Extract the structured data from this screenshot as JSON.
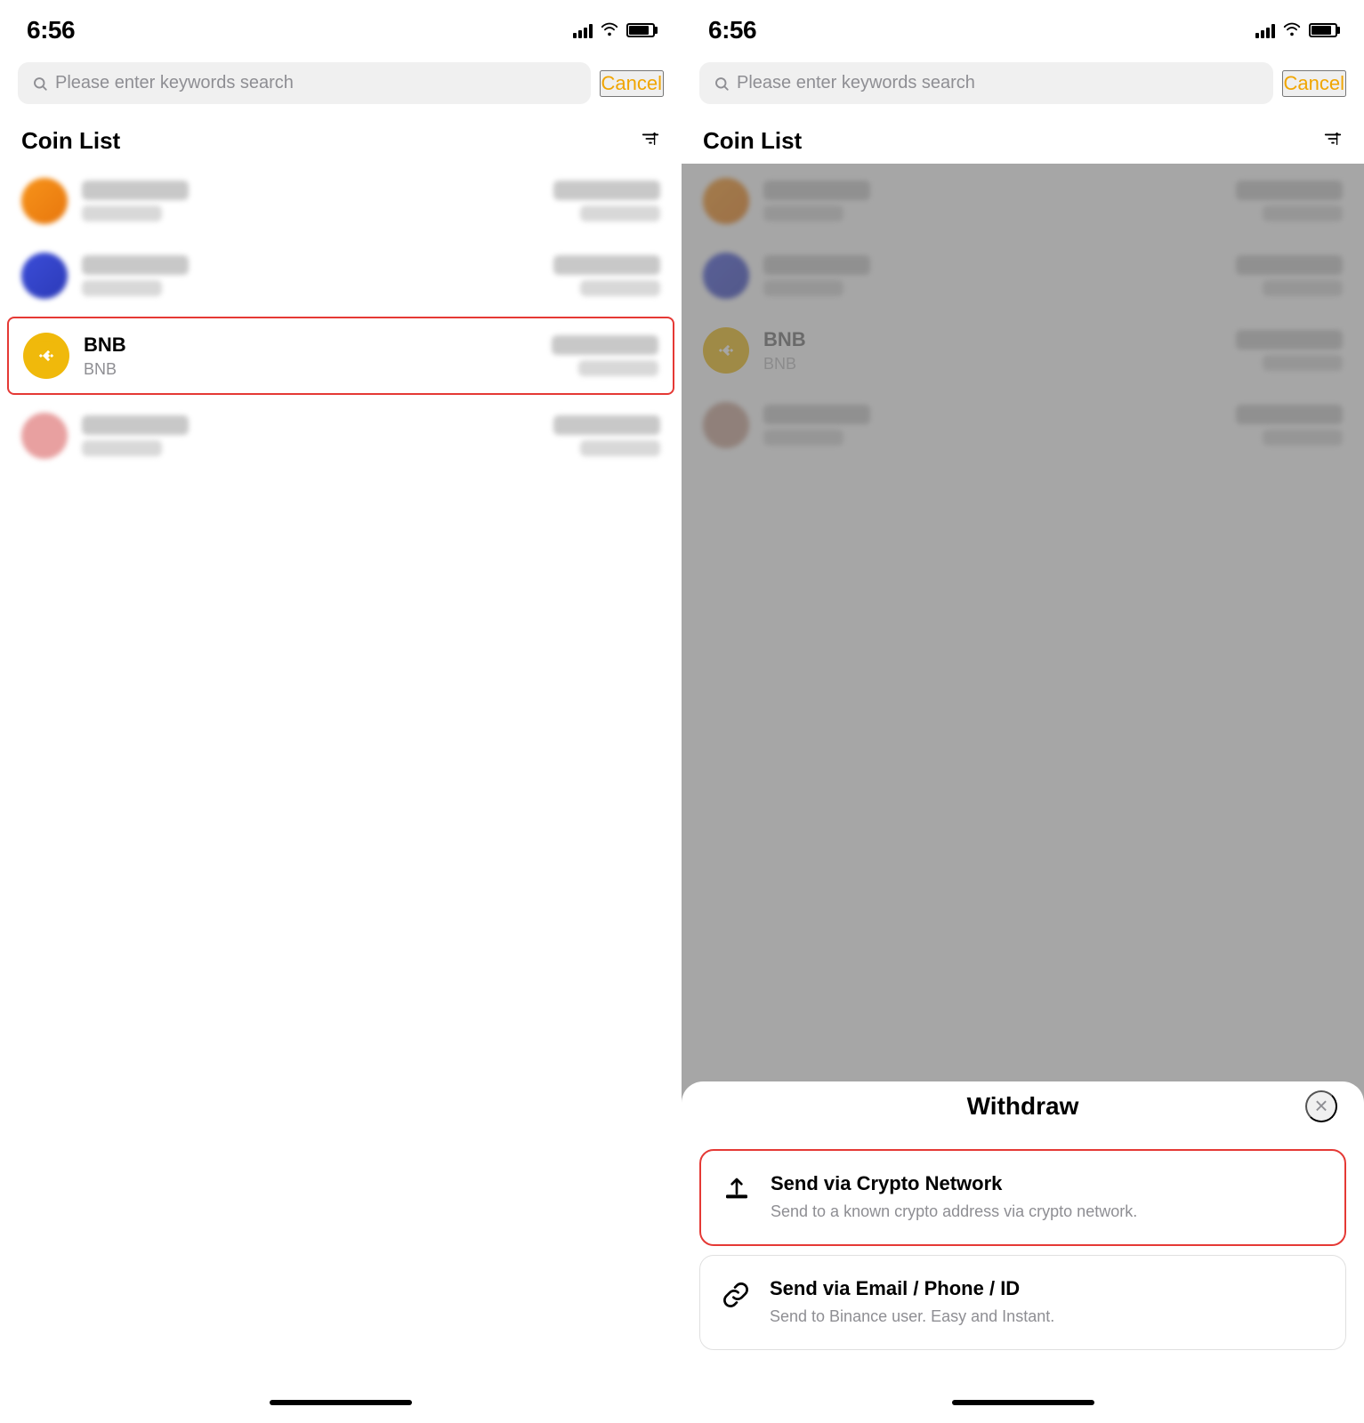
{
  "left": {
    "status": {
      "time": "6:56"
    },
    "search": {
      "placeholder": "Please enter keywords search",
      "cancel_label": "Cancel"
    },
    "coin_list": {
      "title": "Coin List",
      "sort_icon": "↕"
    },
    "coins": [
      {
        "id": "coin1",
        "blurred": true,
        "color": "orange",
        "highlighted": false
      },
      {
        "id": "coin2",
        "blurred": true,
        "color": "blue",
        "highlighted": false
      },
      {
        "id": "bnb",
        "blurred": false,
        "name": "BNB",
        "symbol": "BNB",
        "color": "bnb",
        "highlighted": true
      },
      {
        "id": "coin4",
        "blurred": true,
        "color": "pink",
        "highlighted": false
      }
    ]
  },
  "right": {
    "status": {
      "time": "6:56"
    },
    "search": {
      "placeholder": "Please enter keywords search",
      "cancel_label": "Cancel"
    },
    "coin_list": {
      "title": "Coin List"
    },
    "withdraw": {
      "title": "Withdraw",
      "close_label": "×",
      "options": [
        {
          "id": "crypto-network",
          "title": "Send via Crypto Network",
          "desc": "Send to a known crypto address via crypto network.",
          "highlighted": true
        },
        {
          "id": "email-phone",
          "title": "Send via Email / Phone / ID",
          "desc": "Send to Binance user. Easy and Instant.",
          "highlighted": false
        }
      ]
    }
  }
}
